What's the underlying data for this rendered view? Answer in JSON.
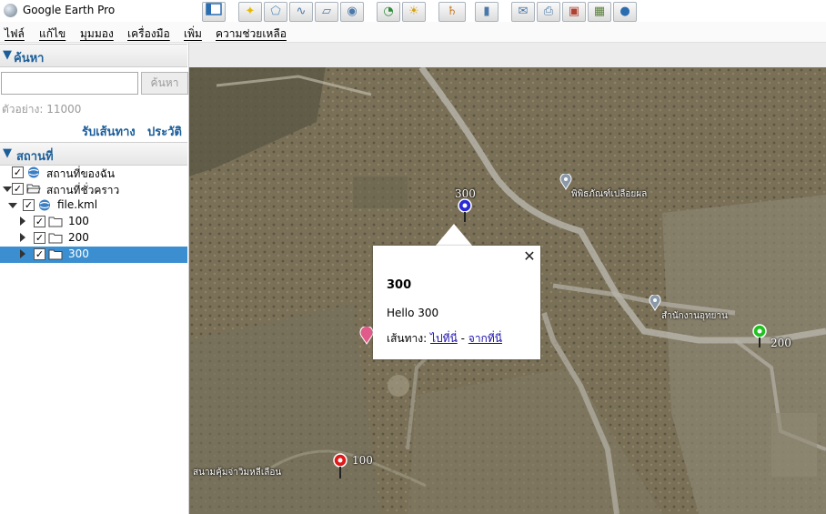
{
  "window": {
    "title": "Google Earth Pro"
  },
  "menu": [
    "ไฟล์",
    "แก้ไข",
    "มุมมอง",
    "เครื่องมือ",
    "เพิ่ม",
    "ความช่วยเหลือ"
  ],
  "search": {
    "header": "ค้นหา",
    "input_value": "",
    "button_label": "ค้นหา",
    "example": "ตัวอย่าง: 11000",
    "directions_link": "รับเส้นทาง",
    "history_link": "ประวัติ"
  },
  "places": {
    "header": "สถานที่",
    "items": [
      {
        "label": "สถานที่ของฉัน",
        "checked": true,
        "icon": "globe-icon"
      },
      {
        "label": "สถานที่ชั่วคราว",
        "checked": true,
        "icon": "folder-open-icon"
      },
      {
        "label": "file.kml",
        "checked": true,
        "icon": "globe-icon"
      },
      {
        "label": "100",
        "checked": true,
        "icon": "folder-icon"
      },
      {
        "label": "200",
        "checked": true,
        "icon": "folder-icon"
      },
      {
        "label": "300",
        "checked": true,
        "icon": "folder-icon",
        "selected": true
      }
    ]
  },
  "toolbar": {
    "buttons": [
      "sidebar-toggle-icon",
      "add-placemark-icon",
      "add-polygon-icon",
      "add-path-icon",
      "add-image-overlay-icon",
      "record-tour-icon",
      "historical-imagery-icon",
      "sunlight-icon",
      "planets-icon",
      "ruler-icon",
      "email-icon",
      "print-icon",
      "save-image-icon",
      "view-in-maps-icon",
      "earth-gallery-icon"
    ]
  },
  "map": {
    "pins": [
      {
        "label": "300",
        "color": "#2b2bd6"
      },
      {
        "label": "200",
        "color": "#1fc21f"
      },
      {
        "label": "100",
        "color": "#e01818"
      }
    ],
    "poi_labels": [
      "พิพิธภัณฑ์เปลือยผล",
      "สำนักงานอุทยาน"
    ],
    "bottom_label": "สนามคุ้มจ่าวิมหลีเลือน"
  },
  "popup": {
    "title": "300",
    "description": "Hello 300",
    "route_prefix": "เส้นทาง:",
    "to_here": "ไปที่นี่",
    "separator": "-",
    "from_here": "จากที่นี่"
  }
}
